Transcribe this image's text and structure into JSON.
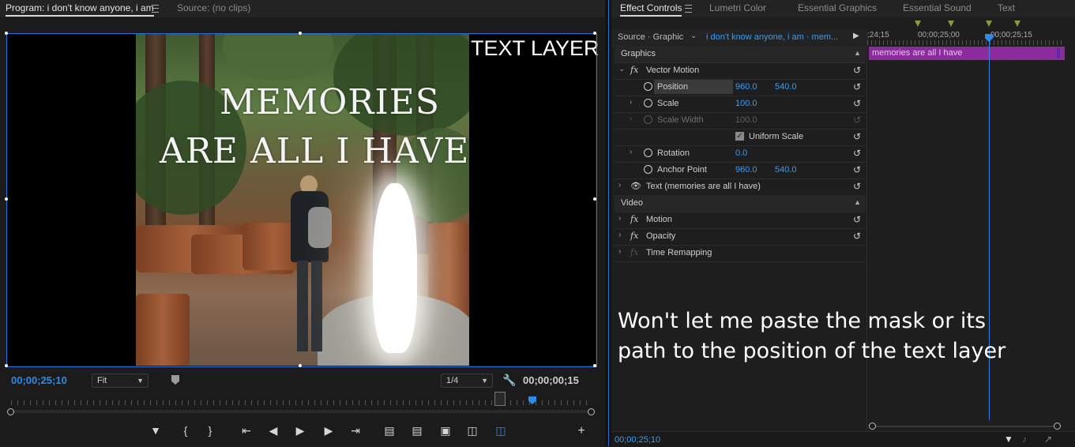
{
  "program_panel": {
    "tab_program": "Program: i don't know anyone, i am",
    "tab_source": "Source: (no clips)",
    "overlay_line1": "MEMORIES",
    "overlay_line2": "ARE ALL I HAVE",
    "text_layer_label": "TEXT LAYER",
    "current_timecode": "00;00;25;10",
    "fit_label": "Fit",
    "resolution_label": "1/4",
    "duration_timecode": "00;00;00;15"
  },
  "right_tabs": [
    "Effect Controls",
    "Lumetri Color",
    "Essential Graphics",
    "Essential Sound",
    "Text"
  ],
  "effect_controls": {
    "source_label": "Source · Graphic",
    "clip_label": "i don't know anyone, i am · mem...",
    "time_left": ";24;15",
    "time_mid": "00;00;25;00",
    "time_right": "00;00;25;15",
    "clip_bar_label": "memories are all I have",
    "section_graphics": "Graphics",
    "vector_motion": "Vector Motion",
    "position_label": "Position",
    "position_x": "960.0",
    "position_y": "540.0",
    "scale_label": "Scale",
    "scale_value": "100.0",
    "scale_width_label": "Scale Width",
    "scale_width_value": "100.0",
    "uniform_scale_label": "Uniform Scale",
    "rotation_label": "Rotation",
    "rotation_value": "0.0",
    "anchor_label": "Anchor Point",
    "anchor_x": "960.0",
    "anchor_y": "540.0",
    "text_layer_row": "Text (memories are all I have)",
    "section_video": "Video",
    "motion_label": "Motion",
    "opacity_label": "Opacity",
    "time_remap_label": "Time Remapping",
    "bottom_timecode": "00;00;25;10"
  },
  "annotation": {
    "line1": "Won't let me paste the mask or its",
    "line2": "path to the position of the text layer"
  },
  "colors": {
    "accent_blue": "#2d8ceb",
    "clip_purple": "#8b2b9c"
  }
}
